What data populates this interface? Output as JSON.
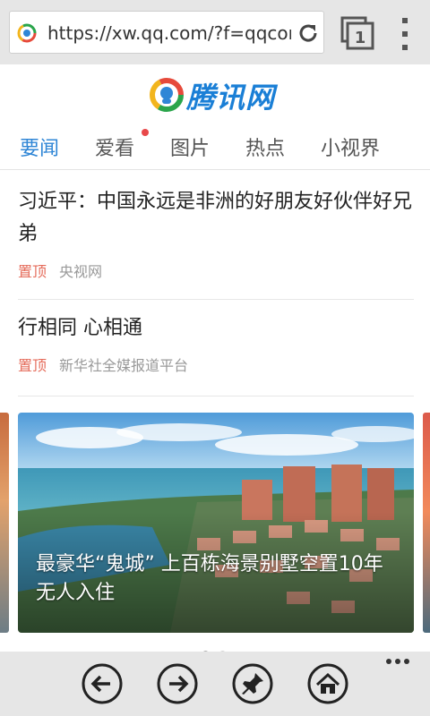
{
  "browser": {
    "url": "https://xw.qq.com/?f=qqcom",
    "tab_count": "1"
  },
  "site": {
    "logo_text": "腾讯网"
  },
  "tabs": [
    {
      "label": "要闻",
      "active": true
    },
    {
      "label": "爱看",
      "active": false,
      "has_badge": true
    },
    {
      "label": "图片",
      "active": false
    },
    {
      "label": "热点",
      "active": false
    },
    {
      "label": "小视界",
      "active": false
    }
  ],
  "news": [
    {
      "title": "习近平：中国永远是非洲的好朋友好伙伴好兄弟",
      "tag": "置顶",
      "source": "央视网"
    },
    {
      "title": "行相同 心相通",
      "tag": "置顶",
      "source": "新华社全媒报道平台"
    }
  ],
  "slideshow": {
    "caption": "最豪华“鬼城” 上百栋海景别墅空置10年无人入住",
    "slide_count": 2,
    "active_index": 0
  },
  "colors": {
    "accent": "#2f86d6",
    "tag": "#e56b5a",
    "badge": "#e8484a",
    "logo": "#1a7fd6"
  }
}
